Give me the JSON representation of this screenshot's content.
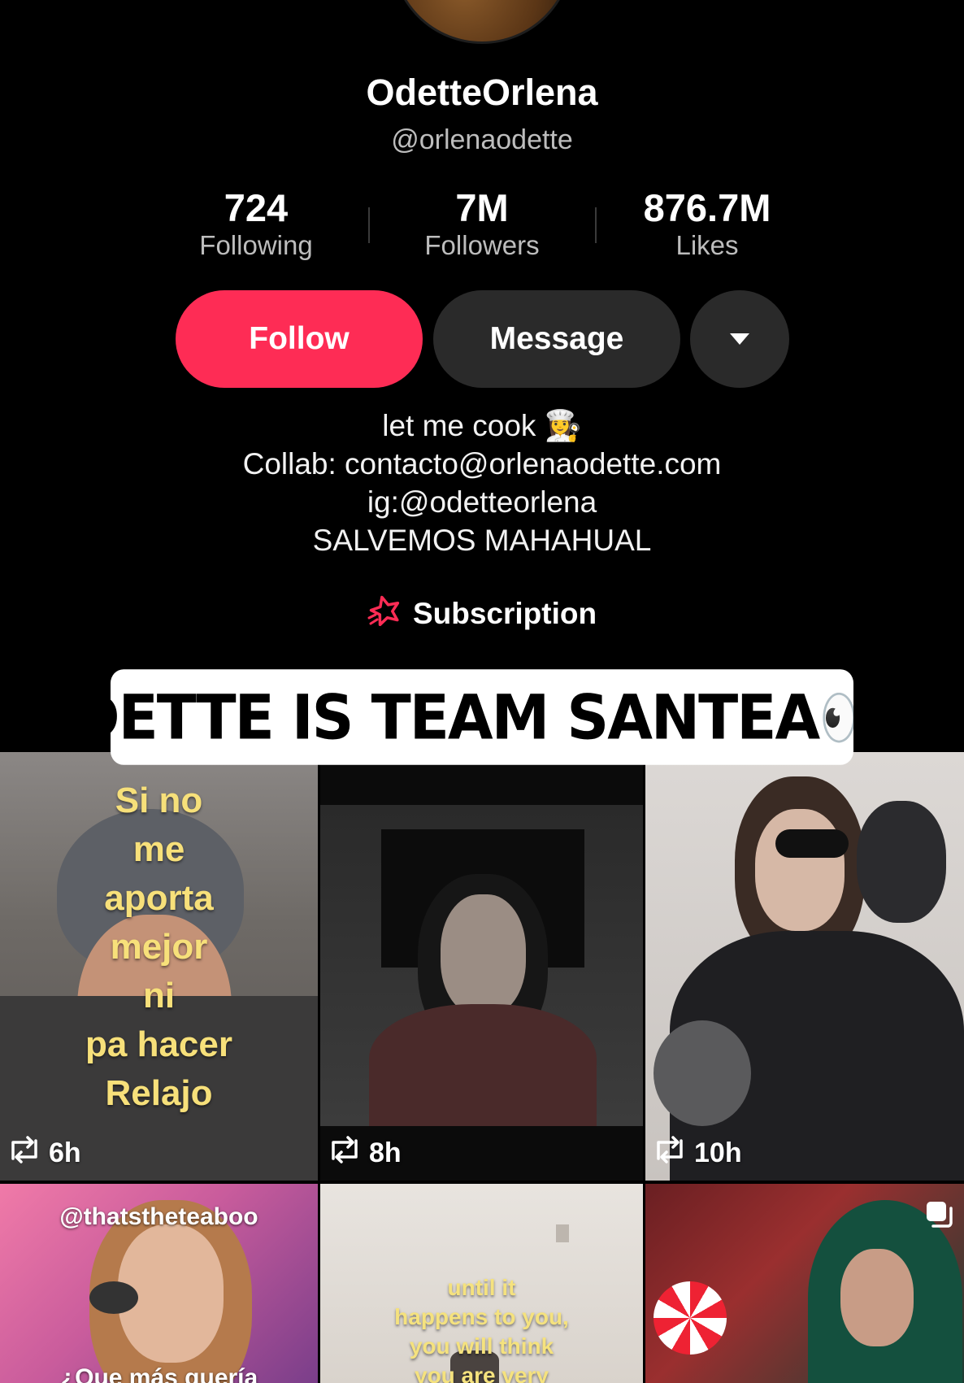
{
  "profile": {
    "display_name": "OdetteOrlena",
    "handle": "@orlenaodette"
  },
  "stats": [
    {
      "value": "724",
      "label": "Following"
    },
    {
      "value": "7M",
      "label": "Followers"
    },
    {
      "value": "876.7M",
      "label": "Likes"
    }
  ],
  "actions": {
    "follow_label": "Follow",
    "message_label": "Message",
    "more_icon": "chevron-down-icon"
  },
  "bio": {
    "line1": "let me cook 👩‍🍳",
    "line2": "Collab: contacto@orlenaodette.com",
    "line3": "ig:@odetteorlena",
    "line4": "SALVEMOS MAHAHUAL"
  },
  "subscription": {
    "icon": "star-icon",
    "label": "Subscription"
  },
  "overlay_caption": "ODETTE IS TEAM SANTEA👀☕",
  "videos": [
    {
      "time": "6h",
      "caption_lines": [
        "Si no",
        "me",
        "aporta",
        "mejor",
        "ni",
        "pa hacer",
        "Relajo"
      ]
    },
    {
      "time": "8h"
    },
    {
      "time": "10h"
    },
    {
      "watermark": "@thatstheteaboo",
      "caption": "¿Que más quería"
    },
    {
      "caption_lines": [
        "until it",
        "happens to you,",
        "you will think",
        "you are very"
      ]
    },
    {
      "icon": "multi-photo-icon"
    }
  ],
  "colors": {
    "follow": "#fe2c55",
    "secondary_button": "#2a2a2a",
    "background": "#000000",
    "caption_yellow": "#f7e07a"
  }
}
